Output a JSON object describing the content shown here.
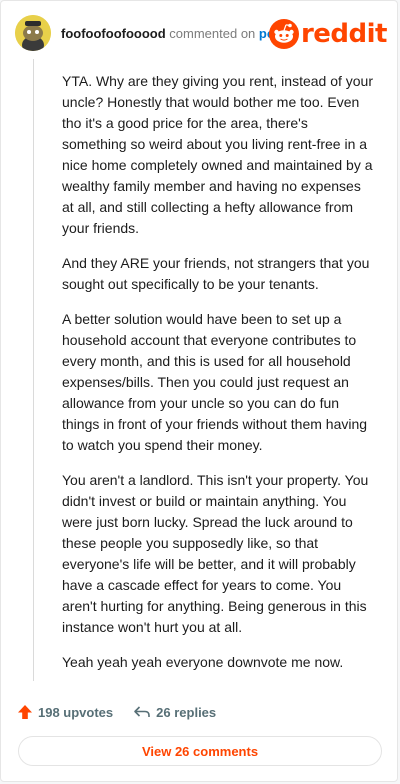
{
  "header": {
    "username": "foofoofoofooood",
    "commented_text": "commented on",
    "post_link": "post",
    "logo_text": "reddit"
  },
  "comment": {
    "paragraphs": [
      "YTA. Why are they giving you rent, instead of your uncle? Honestly that would bother me too. Even tho it's a good price for the area, there's something so weird about you living rent-free in a nice home completely owned and maintained by a wealthy family member and having no expenses at all, and still collecting a hefty allowance from your friends.",
      "And they ARE your friends, not strangers that you sought out specifically to be your tenants.",
      "A better solution would have been to set up a household account that everyone contributes to every month, and this is used for all household expenses/bills. Then you could just request an allowance from your uncle so you can do fun things in front of your friends without them having to watch you spend their money.",
      "You aren't a landlord. This isn't your property. You didn't invest or build or maintain anything. You were just born lucky. Spread the luck around to these people you supposedly like, so that everyone's life will be better, and it will probably have a cascade effect for years to come. You aren't hurting for anything. Being generous in this instance won't hurt you at all.",
      "Yeah yeah yeah everyone downvote me now."
    ]
  },
  "actions": {
    "upvotes": "198 upvotes",
    "replies": "26 replies"
  },
  "view_button": "View 26 comments",
  "colors": {
    "brand": "#ff4500",
    "link": "#0079d3",
    "muted": "#576f76"
  }
}
